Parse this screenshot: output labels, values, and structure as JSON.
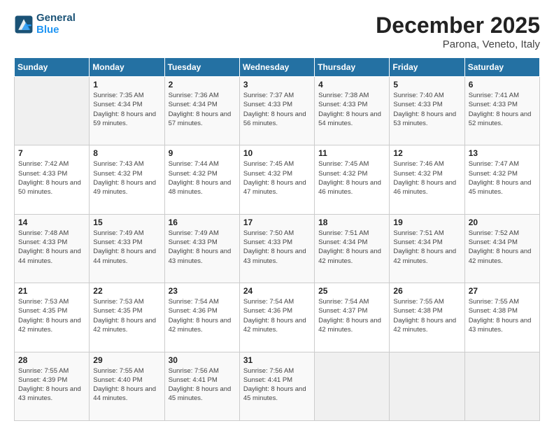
{
  "header": {
    "logo_line1": "General",
    "logo_line2": "Blue",
    "title": "December 2025",
    "subtitle": "Parona, Veneto, Italy"
  },
  "weekdays": [
    "Sunday",
    "Monday",
    "Tuesday",
    "Wednesday",
    "Thursday",
    "Friday",
    "Saturday"
  ],
  "weeks": [
    [
      {
        "day": "",
        "empty": true
      },
      {
        "day": "1",
        "sunrise": "7:35 AM",
        "sunset": "4:34 PM",
        "daylight": "8 hours and 59 minutes."
      },
      {
        "day": "2",
        "sunrise": "7:36 AM",
        "sunset": "4:34 PM",
        "daylight": "8 hours and 57 minutes."
      },
      {
        "day": "3",
        "sunrise": "7:37 AM",
        "sunset": "4:33 PM",
        "daylight": "8 hours and 56 minutes."
      },
      {
        "day": "4",
        "sunrise": "7:38 AM",
        "sunset": "4:33 PM",
        "daylight": "8 hours and 54 minutes."
      },
      {
        "day": "5",
        "sunrise": "7:40 AM",
        "sunset": "4:33 PM",
        "daylight": "8 hours and 53 minutes."
      },
      {
        "day": "6",
        "sunrise": "7:41 AM",
        "sunset": "4:33 PM",
        "daylight": "8 hours and 52 minutes."
      }
    ],
    [
      {
        "day": "7",
        "sunrise": "7:42 AM",
        "sunset": "4:33 PM",
        "daylight": "8 hours and 50 minutes."
      },
      {
        "day": "8",
        "sunrise": "7:43 AM",
        "sunset": "4:32 PM",
        "daylight": "8 hours and 49 minutes."
      },
      {
        "day": "9",
        "sunrise": "7:44 AM",
        "sunset": "4:32 PM",
        "daylight": "8 hours and 48 minutes."
      },
      {
        "day": "10",
        "sunrise": "7:45 AM",
        "sunset": "4:32 PM",
        "daylight": "8 hours and 47 minutes."
      },
      {
        "day": "11",
        "sunrise": "7:45 AM",
        "sunset": "4:32 PM",
        "daylight": "8 hours and 46 minutes."
      },
      {
        "day": "12",
        "sunrise": "7:46 AM",
        "sunset": "4:32 PM",
        "daylight": "8 hours and 46 minutes."
      },
      {
        "day": "13",
        "sunrise": "7:47 AM",
        "sunset": "4:32 PM",
        "daylight": "8 hours and 45 minutes."
      }
    ],
    [
      {
        "day": "14",
        "sunrise": "7:48 AM",
        "sunset": "4:33 PM",
        "daylight": "8 hours and 44 minutes."
      },
      {
        "day": "15",
        "sunrise": "7:49 AM",
        "sunset": "4:33 PM",
        "daylight": "8 hours and 44 minutes."
      },
      {
        "day": "16",
        "sunrise": "7:49 AM",
        "sunset": "4:33 PM",
        "daylight": "8 hours and 43 minutes."
      },
      {
        "day": "17",
        "sunrise": "7:50 AM",
        "sunset": "4:33 PM",
        "daylight": "8 hours and 43 minutes."
      },
      {
        "day": "18",
        "sunrise": "7:51 AM",
        "sunset": "4:34 PM",
        "daylight": "8 hours and 42 minutes."
      },
      {
        "day": "19",
        "sunrise": "7:51 AM",
        "sunset": "4:34 PM",
        "daylight": "8 hours and 42 minutes."
      },
      {
        "day": "20",
        "sunrise": "7:52 AM",
        "sunset": "4:34 PM",
        "daylight": "8 hours and 42 minutes."
      }
    ],
    [
      {
        "day": "21",
        "sunrise": "7:53 AM",
        "sunset": "4:35 PM",
        "daylight": "8 hours and 42 minutes."
      },
      {
        "day": "22",
        "sunrise": "7:53 AM",
        "sunset": "4:35 PM",
        "daylight": "8 hours and 42 minutes."
      },
      {
        "day": "23",
        "sunrise": "7:54 AM",
        "sunset": "4:36 PM",
        "daylight": "8 hours and 42 minutes."
      },
      {
        "day": "24",
        "sunrise": "7:54 AM",
        "sunset": "4:36 PM",
        "daylight": "8 hours and 42 minutes."
      },
      {
        "day": "25",
        "sunrise": "7:54 AM",
        "sunset": "4:37 PM",
        "daylight": "8 hours and 42 minutes."
      },
      {
        "day": "26",
        "sunrise": "7:55 AM",
        "sunset": "4:38 PM",
        "daylight": "8 hours and 42 minutes."
      },
      {
        "day": "27",
        "sunrise": "7:55 AM",
        "sunset": "4:38 PM",
        "daylight": "8 hours and 43 minutes."
      }
    ],
    [
      {
        "day": "28",
        "sunrise": "7:55 AM",
        "sunset": "4:39 PM",
        "daylight": "8 hours and 43 minutes."
      },
      {
        "day": "29",
        "sunrise": "7:55 AM",
        "sunset": "4:40 PM",
        "daylight": "8 hours and 44 minutes."
      },
      {
        "day": "30",
        "sunrise": "7:56 AM",
        "sunset": "4:41 PM",
        "daylight": "8 hours and 45 minutes."
      },
      {
        "day": "31",
        "sunrise": "7:56 AM",
        "sunset": "4:41 PM",
        "daylight": "8 hours and 45 minutes."
      },
      {
        "day": "",
        "empty": true
      },
      {
        "day": "",
        "empty": true
      },
      {
        "day": "",
        "empty": true
      }
    ]
  ]
}
